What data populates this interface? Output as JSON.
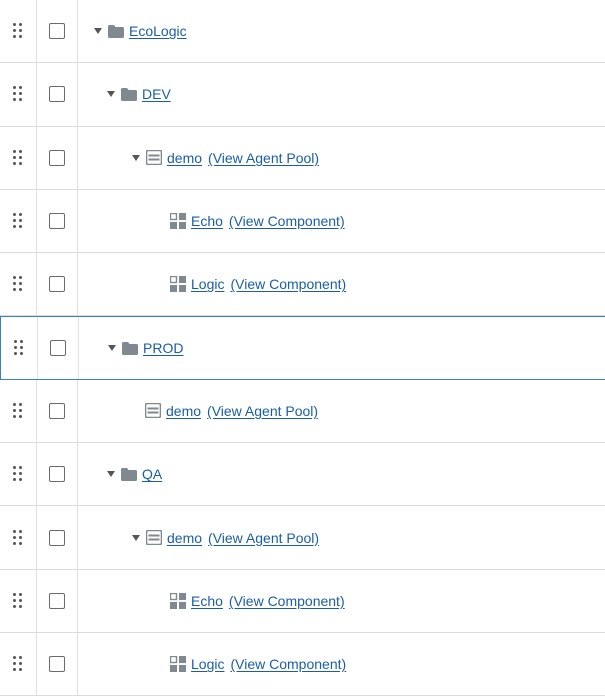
{
  "rows": [
    {
      "name": "EcoLogic",
      "type": "folder",
      "expanded": true,
      "link_label": ""
    },
    {
      "name": "DEV",
      "type": "folder",
      "expanded": true,
      "link_label": ""
    },
    {
      "name": "demo",
      "type": "agent-pool",
      "expanded": true,
      "link_label": "(View Agent Pool)"
    },
    {
      "name": "Echo",
      "type": "component",
      "expanded": false,
      "link_label": "(View Component)"
    },
    {
      "name": "Logic",
      "type": "component",
      "expanded": false,
      "link_label": "(View Component)"
    },
    {
      "name": "PROD",
      "type": "folder",
      "expanded": true,
      "link_label": "",
      "selected": true
    },
    {
      "name": "demo",
      "type": "agent-pool",
      "expanded": false,
      "link_label": "(View Agent Pool)"
    },
    {
      "name": "QA",
      "type": "folder",
      "expanded": true,
      "link_label": ""
    },
    {
      "name": "demo",
      "type": "agent-pool",
      "expanded": true,
      "link_label": "(View Agent Pool)"
    },
    {
      "name": "Echo",
      "type": "component",
      "expanded": false,
      "link_label": "(View Component)"
    },
    {
      "name": "Logic",
      "type": "component",
      "expanded": false,
      "link_label": "(View Component)"
    }
  ],
  "colors": {
    "link": "#1a5ea8",
    "icon": "#808890",
    "selection_border": "#3b7fc4",
    "row_border": "#dcdcdc"
  }
}
